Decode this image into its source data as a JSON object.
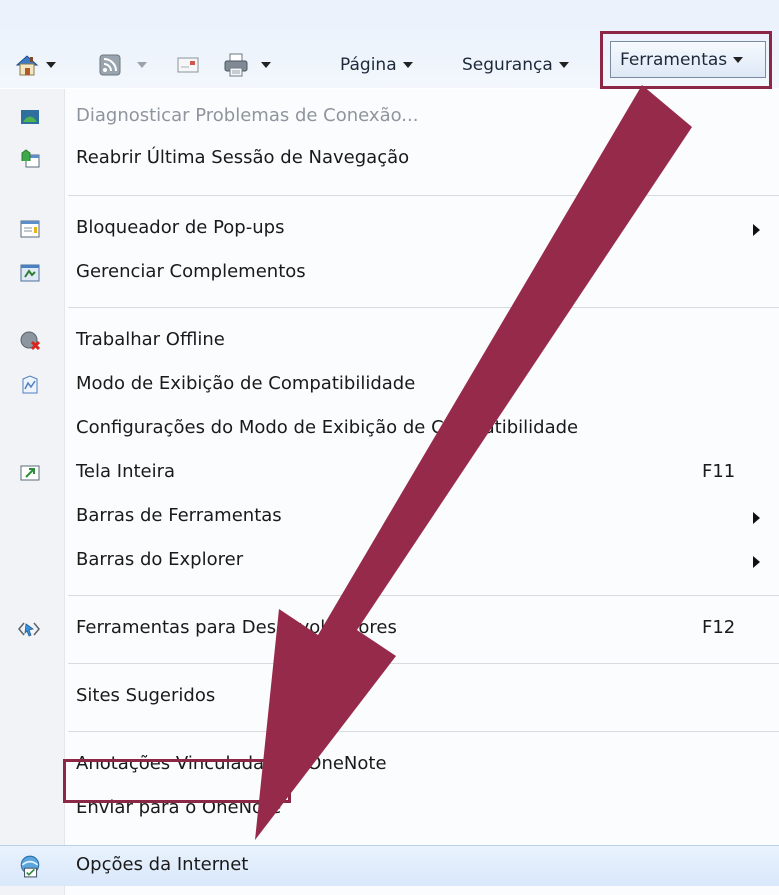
{
  "toolbar": {
    "page_label": "Página",
    "security_label": "Segurança",
    "tools_label": "Ferramentas"
  },
  "menu": {
    "diagnose": "Diagnosticar Problemas de Conexão...",
    "reopen": "Reabrir Última Sessão de Navegação",
    "popup_blocker": "Bloqueador de Pop-ups",
    "manage_addons": "Gerenciar Complementos",
    "work_offline": "Trabalhar Offline",
    "compat_view": "Modo de Exibição de Compatibilidade",
    "compat_settings": "Configurações do Modo de Exibição de Compatibilidade",
    "full_screen": "Tela Inteira",
    "full_screen_key": "F11",
    "toolbars": "Barras de Ferramentas",
    "explorer_bars": "Barras do Explorer",
    "dev_tools": "Ferramentas para Desenvolvedores",
    "dev_tools_key": "F12",
    "suggested_sites": "Sites Sugeridos",
    "onenote_linked": "Anotações Vinculadas do OneNote",
    "send_onenote": "Enviar para o OneNote",
    "internet_options": "Opções da Internet"
  },
  "colors": {
    "highlight": "#8c2846",
    "arrow": "#962a4a"
  }
}
